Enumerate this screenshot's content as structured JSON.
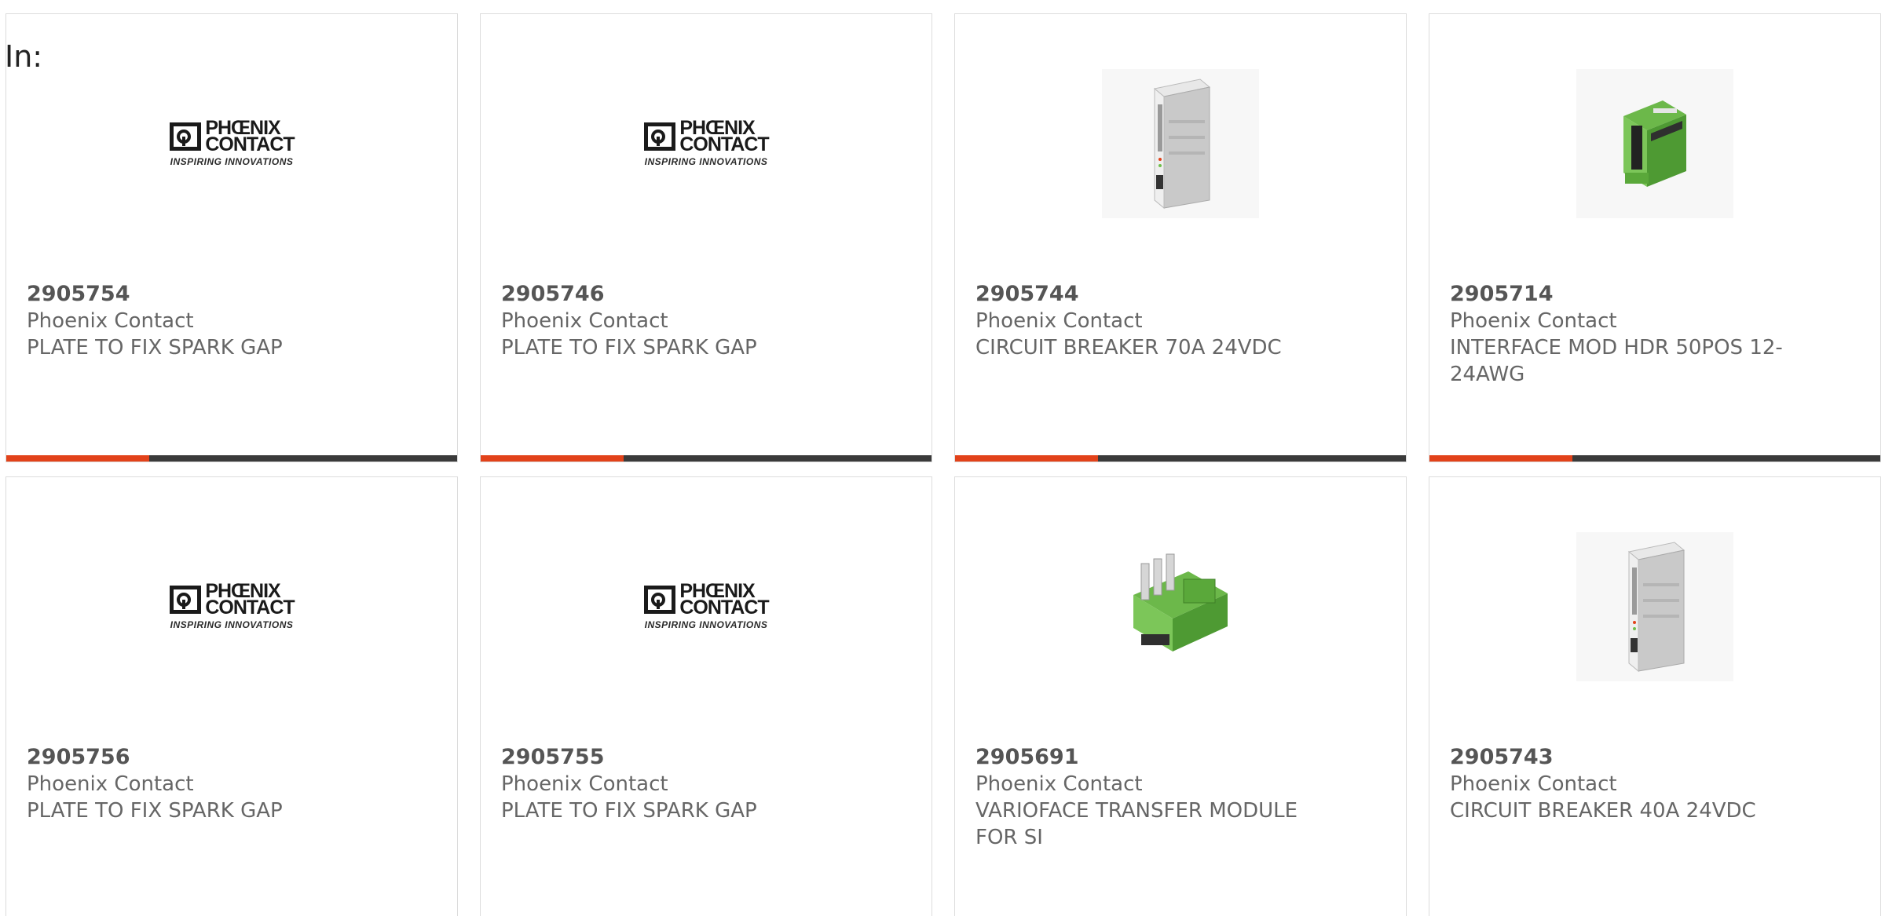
{
  "header": {
    "in_label": "In:"
  },
  "products": [
    {
      "sku": "2905754",
      "brand": "Phoenix Contact",
      "description": "PLATE TO FIX SPARK GAP",
      "image": "phoenix-contact-logo"
    },
    {
      "sku": "2905746",
      "brand": "Phoenix Contact",
      "description": "PLATE TO FIX SPARK GAP",
      "image": "phoenix-contact-logo"
    },
    {
      "sku": "2905744",
      "brand": "Phoenix Contact",
      "description": "CIRCUIT BREAKER 70A 24VDC",
      "image": "circuit-breaker-photo"
    },
    {
      "sku": "2905714",
      "brand": "Phoenix Contact",
      "description": "INTERFACE MOD HDR 50POS 12-24AWG",
      "image": "interface-module-photo"
    },
    {
      "sku": "2905756",
      "brand": "Phoenix Contact",
      "description": "PLATE TO FIX SPARK GAP",
      "image": "phoenix-contact-logo"
    },
    {
      "sku": "2905755",
      "brand": "Phoenix Contact",
      "description": "PLATE TO FIX SPARK GAP",
      "image": "phoenix-contact-logo"
    },
    {
      "sku": "2905691",
      "brand": "Phoenix Contact",
      "description": "VARIOFACE TRANSFER MODULE FOR SI",
      "image": "transfer-module-photo"
    },
    {
      "sku": "2905743",
      "brand": "Phoenix Contact",
      "description": "CIRCUIT BREAKER 40A 24VDC",
      "image": "circuit-breaker-photo"
    }
  ],
  "logo": {
    "line1": "PHŒNIX",
    "line2": "CONTACT",
    "tagline": "INSPIRING INNOVATIONS"
  },
  "colors": {
    "accent": "#e2421a",
    "bar": "#3a3a3a",
    "card_border": "#dcdcdc",
    "text": "#666666",
    "module_green": "#5aa83a",
    "housing_gray": "#d9d9d9"
  }
}
